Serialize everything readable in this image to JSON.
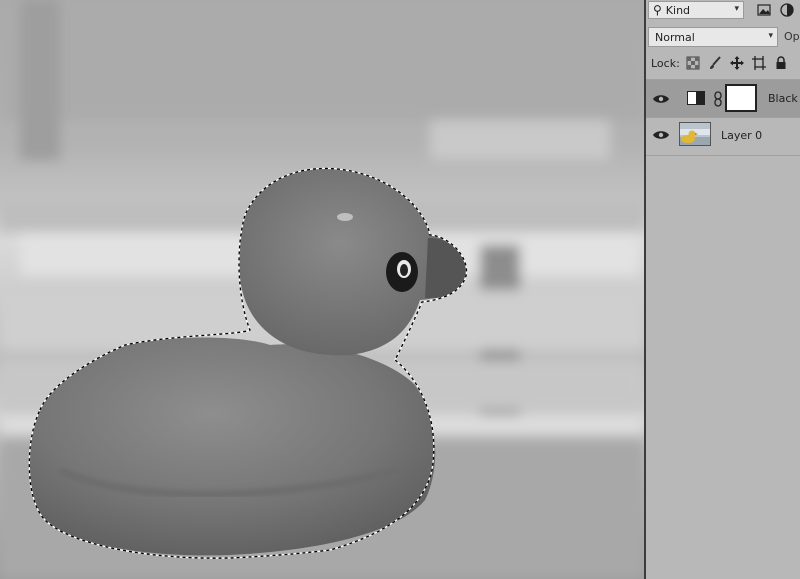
{
  "layers_panel": {
    "filter": {
      "label": "Kind",
      "search_icon": "search-icon"
    },
    "blend_mode": "Normal",
    "opacity_label": "Op",
    "lock_label": "Lock:",
    "layers": [
      {
        "name": "Black &",
        "type": "adjustment",
        "active": true,
        "visible": true
      },
      {
        "name": "Layer 0",
        "type": "pixel",
        "active": false,
        "visible": true
      }
    ]
  }
}
